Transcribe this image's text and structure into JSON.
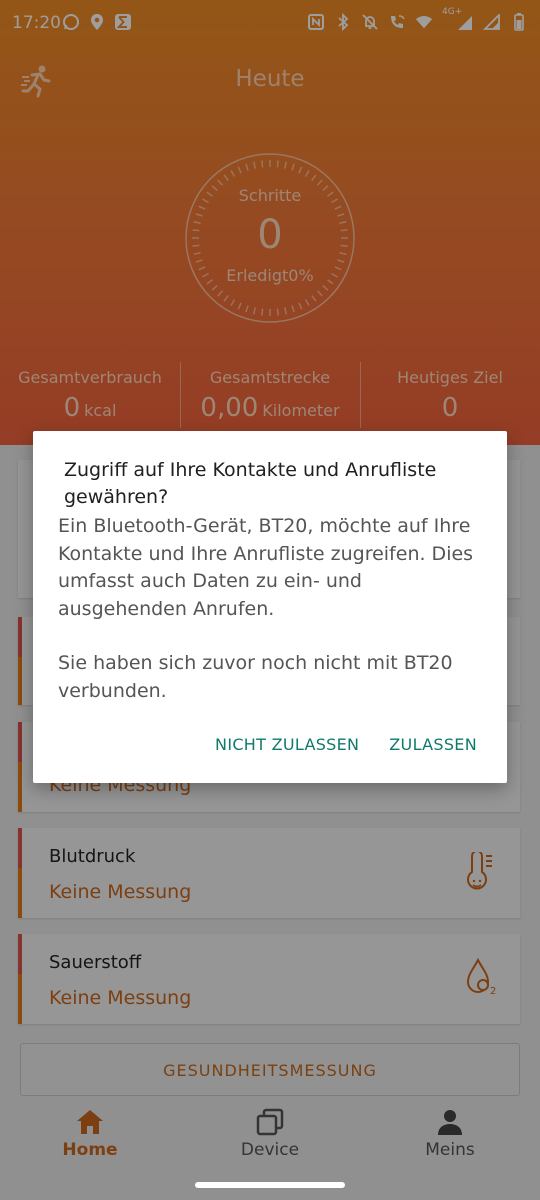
{
  "status_bar": {
    "time": "17:20",
    "left_icons": [
      "whatsapp-icon",
      "location-icon",
      "sigma-app-icon"
    ],
    "right_icons": [
      "nfc-icon",
      "bluetooth-icon",
      "alarm-off-icon",
      "wifi-calling-icon",
      "wifi-icon",
      "signal-4g-plus-icon",
      "signal-icon",
      "battery-icon"
    ],
    "network_label": "4G+"
  },
  "hero": {
    "title": "Heute",
    "ring": {
      "label": "Schritte",
      "value": "0",
      "done_text": "Erledigt0%",
      "progress_percent": 0
    },
    "stats": [
      {
        "label": "Gesamtverbrauch",
        "value": "0",
        "unit": "kcal"
      },
      {
        "label": "Gesamtstrecke",
        "value": "0,00",
        "unit": "Kilometer"
      },
      {
        "label": "Heutiges Ziel",
        "value": "0",
        "unit": ""
      }
    ]
  },
  "cards": [
    {
      "title": "Blutdruck",
      "subtitle": "Keine Messung",
      "icon": "thermometer-face-icon"
    },
    {
      "title": "Sauerstoff",
      "subtitle": "Keine Messung",
      "icon": "oxygen-drop-icon"
    }
  ],
  "partially_visible": {
    "card_subtitle": "Keine Messung"
  },
  "measure_button": "GESUNDHEITSMESSUNG",
  "nav": {
    "items": [
      {
        "label": "Home",
        "icon": "home-icon",
        "active": true
      },
      {
        "label": "Device",
        "icon": "device-icon",
        "active": false
      },
      {
        "label": "Meins",
        "icon": "person-icon",
        "active": false
      }
    ]
  },
  "dialog": {
    "title": "Zugriff auf Ihre Kontakte und Anrufliste gewähren?",
    "body_1": "Ein Bluetooth-Gerät, BT20, möchte auf Ihre Kontakte und Ihre Anrufliste zugreifen. Dies umfasst auch Daten zu ein- und ausgehenden Anrufen.",
    "body_2": "Sie haben sich zuvor noch nicht mit BT20 verbunden.",
    "deny_label": "NICHT ZULASSEN",
    "allow_label": "ZULASSEN"
  },
  "colors": {
    "accent": "#e07a18",
    "hero_top": "#ee8c24",
    "hero_bottom": "#f0623e",
    "dialog_button": "#0f7a6b"
  }
}
